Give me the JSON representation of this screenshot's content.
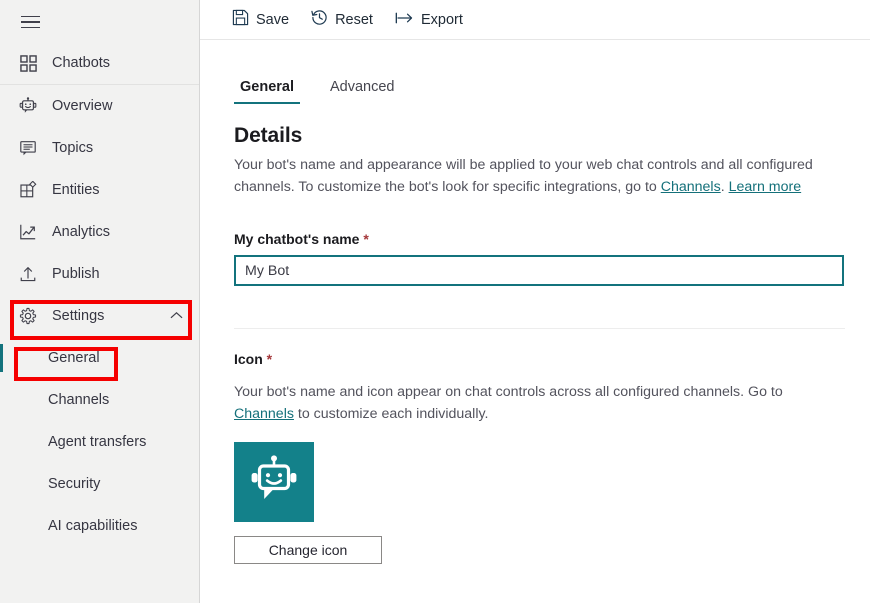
{
  "sidebar": {
    "menu_icon": "hamburger-icon",
    "top_items": [
      {
        "label": "Chatbots",
        "icon": "grid-icon"
      }
    ],
    "items": [
      {
        "label": "Overview",
        "icon": "robot-icon"
      },
      {
        "label": "Topics",
        "icon": "chat-bubble-icon"
      },
      {
        "label": "Entities",
        "icon": "entities-icon"
      },
      {
        "label": "Analytics",
        "icon": "line-chart-icon"
      },
      {
        "label": "Publish",
        "icon": "upload-icon"
      }
    ],
    "settings": {
      "label": "Settings",
      "icon": "gear-icon",
      "chevron": "chevron-up-icon",
      "expanded": true,
      "sub_items": [
        {
          "label": "General",
          "selected": true
        },
        {
          "label": "Channels",
          "selected": false
        },
        {
          "label": "Agent transfers",
          "selected": false
        },
        {
          "label": "Security",
          "selected": false
        },
        {
          "label": "AI capabilities",
          "selected": false
        }
      ]
    }
  },
  "toolbar": {
    "save_label": "Save",
    "reset_label": "Reset",
    "export_label": "Export",
    "save_icon": "floppy-disk-icon",
    "reset_icon": "history-clock-icon",
    "export_icon": "export-arrow-icon"
  },
  "tabs": [
    {
      "label": "General",
      "active": true
    },
    {
      "label": "Advanced",
      "active": false
    }
  ],
  "details": {
    "title": "Details",
    "description_part1": "Your bot's name and appearance will be applied to your web chat controls and all configured channels. To customize the bot's look for specific integrations, go to ",
    "link_channels": "Channels",
    "description_part2": ". ",
    "link_learn_more": "Learn more"
  },
  "name_field": {
    "label": "My chatbot's name",
    "required_marker": "*",
    "value": "My Bot",
    "placeholder": "My Bot"
  },
  "icon_section": {
    "label": "Icon",
    "required_marker": "*",
    "description_part1": "Your bot's name and icon appear on chat controls across all configured channels. Go to ",
    "link_channels": "Channels",
    "description_part2": " to customize each individually.",
    "bot_icon": "bot-avatar-icon",
    "change_button_label": "Change icon"
  },
  "colors": {
    "accent_teal": "#13737d",
    "bot_icon_background": "#13818a",
    "annotation_red": "#f50000",
    "sidebar_background": "#f2f2f1",
    "required_asterisk": "#a4373a"
  },
  "annotations": [
    {
      "name": "settings-highlight",
      "target": "Settings"
    },
    {
      "name": "general-highlight",
      "target": "General"
    }
  ]
}
